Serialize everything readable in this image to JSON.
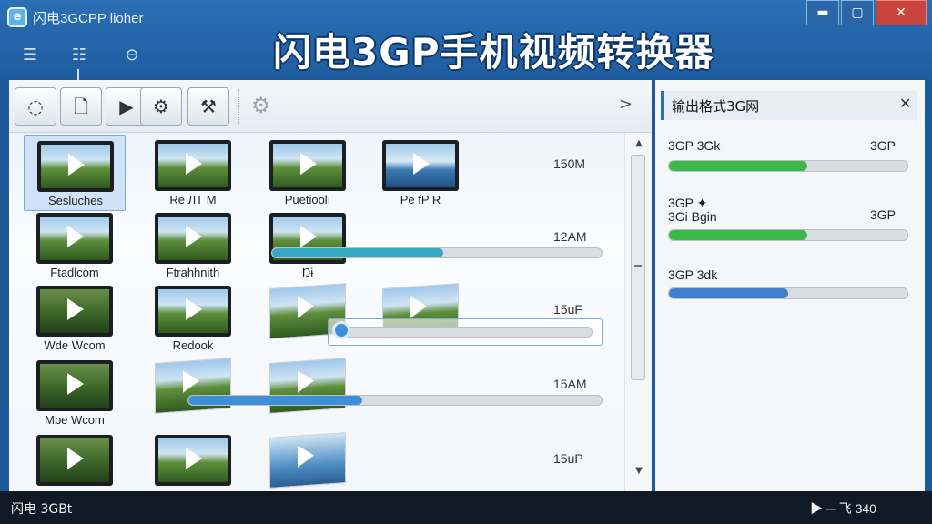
{
  "window": {
    "app_name": "闪电3GCPP lioher",
    "title": "闪电3GP手机视频转换器",
    "minimize": "▬",
    "maximize": "▢",
    "close": "✕"
  },
  "view_buttons": [
    {
      "icon": "list-icon",
      "glyph": "☰"
    },
    {
      "icon": "detail-list-icon",
      "glyph": "☷"
    },
    {
      "icon": "minus-circle-icon",
      "glyph": "⊖"
    }
  ],
  "toolbar": {
    "buttons": [
      {
        "icon": "lasso-icon",
        "glyph": "◌"
      },
      {
        "icon": "add-file-icon",
        "glyph": "🗋"
      },
      {
        "icon": "play-icon",
        "glyph": "▶"
      },
      {
        "icon": "gear-icon",
        "glyph": "⚙"
      },
      {
        "icon": "tools-icon",
        "glyph": "⚒"
      }
    ],
    "disabled_gear": "⚙",
    "next": ">"
  },
  "files": [
    {
      "label": "Sesluches",
      "selected": true
    },
    {
      "label": "Re ЛТ M"
    },
    {
      "label": "Puetioolı"
    },
    {
      "label": "Pe fP R"
    },
    {
      "label": "Ftadlcom"
    },
    {
      "label": "Ftrahhnith"
    },
    {
      "label": "Wde Wcom"
    },
    {
      "label": "Redook"
    },
    {
      "label": "Mbe Wcom"
    }
  ],
  "row_sizes": [
    "150M",
    "12AM",
    "15uF",
    "15AM",
    "15uP"
  ],
  "row_progress": [
    {
      "value": 0.52,
      "color": "#35a9c4"
    },
    {
      "value": 0.0,
      "color": "#3f8fd6"
    },
    {
      "value": 0.42,
      "color": "#3f8fd6"
    }
  ],
  "progress_misc": {
    "sub_label": "Ŋɨ"
  },
  "side_panel": {
    "title": "输出格式3G网",
    "close": "✕",
    "formats": [
      {
        "name": "3GP 3Gk",
        "right": "3GP",
        "progress": 0.58,
        "color": "#3db84a"
      },
      {
        "name": "3GP ✦\n3Gi  Bgin",
        "right": "3GP",
        "progress": 0.58,
        "color": "#3db84a"
      },
      {
        "name": "3GP 3dk",
        "right": "",
        "progress": 0.5,
        "color": "#3f7fd0"
      }
    ]
  },
  "status": {
    "left": "闪电 3GBt",
    "right": "▶ ─ 飞 340"
  },
  "scroll": {
    "up": "▲",
    "down": "▼"
  }
}
